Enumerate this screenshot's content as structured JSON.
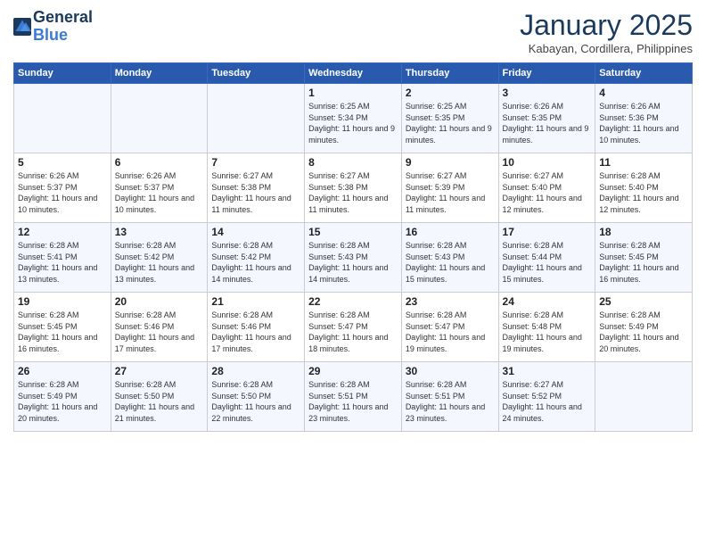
{
  "header": {
    "logo_line1": "General",
    "logo_line2": "Blue",
    "month": "January 2025",
    "location": "Kabayan, Cordillera, Philippines"
  },
  "days_of_week": [
    "Sunday",
    "Monday",
    "Tuesday",
    "Wednesday",
    "Thursday",
    "Friday",
    "Saturday"
  ],
  "weeks": [
    [
      {
        "day": "",
        "sunrise": "",
        "sunset": "",
        "daylight": ""
      },
      {
        "day": "",
        "sunrise": "",
        "sunset": "",
        "daylight": ""
      },
      {
        "day": "",
        "sunrise": "",
        "sunset": "",
        "daylight": ""
      },
      {
        "day": "1",
        "sunrise": "Sunrise: 6:25 AM",
        "sunset": "Sunset: 5:34 PM",
        "daylight": "Daylight: 11 hours and 9 minutes."
      },
      {
        "day": "2",
        "sunrise": "Sunrise: 6:25 AM",
        "sunset": "Sunset: 5:35 PM",
        "daylight": "Daylight: 11 hours and 9 minutes."
      },
      {
        "day": "3",
        "sunrise": "Sunrise: 6:26 AM",
        "sunset": "Sunset: 5:35 PM",
        "daylight": "Daylight: 11 hours and 9 minutes."
      },
      {
        "day": "4",
        "sunrise": "Sunrise: 6:26 AM",
        "sunset": "Sunset: 5:36 PM",
        "daylight": "Daylight: 11 hours and 10 minutes."
      }
    ],
    [
      {
        "day": "5",
        "sunrise": "Sunrise: 6:26 AM",
        "sunset": "Sunset: 5:37 PM",
        "daylight": "Daylight: 11 hours and 10 minutes."
      },
      {
        "day": "6",
        "sunrise": "Sunrise: 6:26 AM",
        "sunset": "Sunset: 5:37 PM",
        "daylight": "Daylight: 11 hours and 10 minutes."
      },
      {
        "day": "7",
        "sunrise": "Sunrise: 6:27 AM",
        "sunset": "Sunset: 5:38 PM",
        "daylight": "Daylight: 11 hours and 11 minutes."
      },
      {
        "day": "8",
        "sunrise": "Sunrise: 6:27 AM",
        "sunset": "Sunset: 5:38 PM",
        "daylight": "Daylight: 11 hours and 11 minutes."
      },
      {
        "day": "9",
        "sunrise": "Sunrise: 6:27 AM",
        "sunset": "Sunset: 5:39 PM",
        "daylight": "Daylight: 11 hours and 11 minutes."
      },
      {
        "day": "10",
        "sunrise": "Sunrise: 6:27 AM",
        "sunset": "Sunset: 5:40 PM",
        "daylight": "Daylight: 11 hours and 12 minutes."
      },
      {
        "day": "11",
        "sunrise": "Sunrise: 6:28 AM",
        "sunset": "Sunset: 5:40 PM",
        "daylight": "Daylight: 11 hours and 12 minutes."
      }
    ],
    [
      {
        "day": "12",
        "sunrise": "Sunrise: 6:28 AM",
        "sunset": "Sunset: 5:41 PM",
        "daylight": "Daylight: 11 hours and 13 minutes."
      },
      {
        "day": "13",
        "sunrise": "Sunrise: 6:28 AM",
        "sunset": "Sunset: 5:42 PM",
        "daylight": "Daylight: 11 hours and 13 minutes."
      },
      {
        "day": "14",
        "sunrise": "Sunrise: 6:28 AM",
        "sunset": "Sunset: 5:42 PM",
        "daylight": "Daylight: 11 hours and 14 minutes."
      },
      {
        "day": "15",
        "sunrise": "Sunrise: 6:28 AM",
        "sunset": "Sunset: 5:43 PM",
        "daylight": "Daylight: 11 hours and 14 minutes."
      },
      {
        "day": "16",
        "sunrise": "Sunrise: 6:28 AM",
        "sunset": "Sunset: 5:43 PM",
        "daylight": "Daylight: 11 hours and 15 minutes."
      },
      {
        "day": "17",
        "sunrise": "Sunrise: 6:28 AM",
        "sunset": "Sunset: 5:44 PM",
        "daylight": "Daylight: 11 hours and 15 minutes."
      },
      {
        "day": "18",
        "sunrise": "Sunrise: 6:28 AM",
        "sunset": "Sunset: 5:45 PM",
        "daylight": "Daylight: 11 hours and 16 minutes."
      }
    ],
    [
      {
        "day": "19",
        "sunrise": "Sunrise: 6:28 AM",
        "sunset": "Sunset: 5:45 PM",
        "daylight": "Daylight: 11 hours and 16 minutes."
      },
      {
        "day": "20",
        "sunrise": "Sunrise: 6:28 AM",
        "sunset": "Sunset: 5:46 PM",
        "daylight": "Daylight: 11 hours and 17 minutes."
      },
      {
        "day": "21",
        "sunrise": "Sunrise: 6:28 AM",
        "sunset": "Sunset: 5:46 PM",
        "daylight": "Daylight: 11 hours and 17 minutes."
      },
      {
        "day": "22",
        "sunrise": "Sunrise: 6:28 AM",
        "sunset": "Sunset: 5:47 PM",
        "daylight": "Daylight: 11 hours and 18 minutes."
      },
      {
        "day": "23",
        "sunrise": "Sunrise: 6:28 AM",
        "sunset": "Sunset: 5:47 PM",
        "daylight": "Daylight: 11 hours and 19 minutes."
      },
      {
        "day": "24",
        "sunrise": "Sunrise: 6:28 AM",
        "sunset": "Sunset: 5:48 PM",
        "daylight": "Daylight: 11 hours and 19 minutes."
      },
      {
        "day": "25",
        "sunrise": "Sunrise: 6:28 AM",
        "sunset": "Sunset: 5:49 PM",
        "daylight": "Daylight: 11 hours and 20 minutes."
      }
    ],
    [
      {
        "day": "26",
        "sunrise": "Sunrise: 6:28 AM",
        "sunset": "Sunset: 5:49 PM",
        "daylight": "Daylight: 11 hours and 20 minutes."
      },
      {
        "day": "27",
        "sunrise": "Sunrise: 6:28 AM",
        "sunset": "Sunset: 5:50 PM",
        "daylight": "Daylight: 11 hours and 21 minutes."
      },
      {
        "day": "28",
        "sunrise": "Sunrise: 6:28 AM",
        "sunset": "Sunset: 5:50 PM",
        "daylight": "Daylight: 11 hours and 22 minutes."
      },
      {
        "day": "29",
        "sunrise": "Sunrise: 6:28 AM",
        "sunset": "Sunset: 5:51 PM",
        "daylight": "Daylight: 11 hours and 23 minutes."
      },
      {
        "day": "30",
        "sunrise": "Sunrise: 6:28 AM",
        "sunset": "Sunset: 5:51 PM",
        "daylight": "Daylight: 11 hours and 23 minutes."
      },
      {
        "day": "31",
        "sunrise": "Sunrise: 6:27 AM",
        "sunset": "Sunset: 5:52 PM",
        "daylight": "Daylight: 11 hours and 24 minutes."
      },
      {
        "day": "",
        "sunrise": "",
        "sunset": "",
        "daylight": ""
      }
    ]
  ]
}
